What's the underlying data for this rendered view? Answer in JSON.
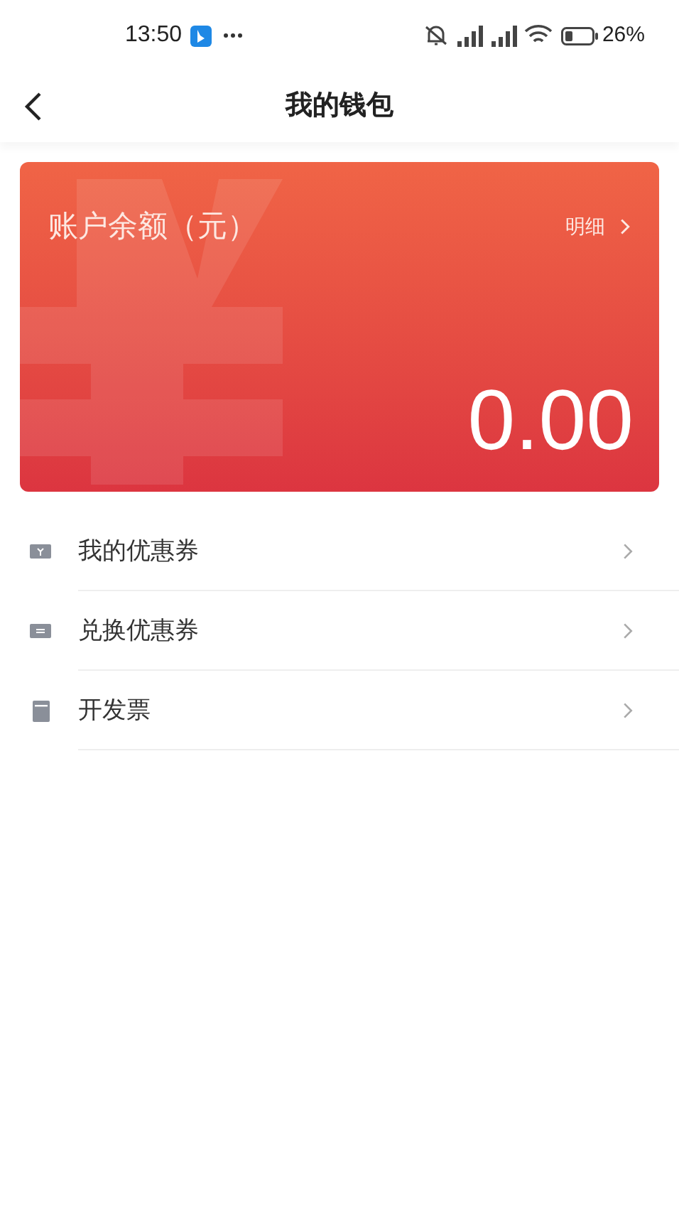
{
  "status_bar": {
    "time": "13:50",
    "battery": "26%"
  },
  "header": {
    "title": "我的钱包"
  },
  "balance_card": {
    "label": "账户余额（元）",
    "details_link": "明细",
    "amount": "0.00"
  },
  "menu": [
    {
      "kind": "coupon",
      "label": "我的优惠券"
    },
    {
      "kind": "exchange",
      "label": "兑换优惠券"
    },
    {
      "kind": "invoice",
      "label": "开发票"
    }
  ]
}
